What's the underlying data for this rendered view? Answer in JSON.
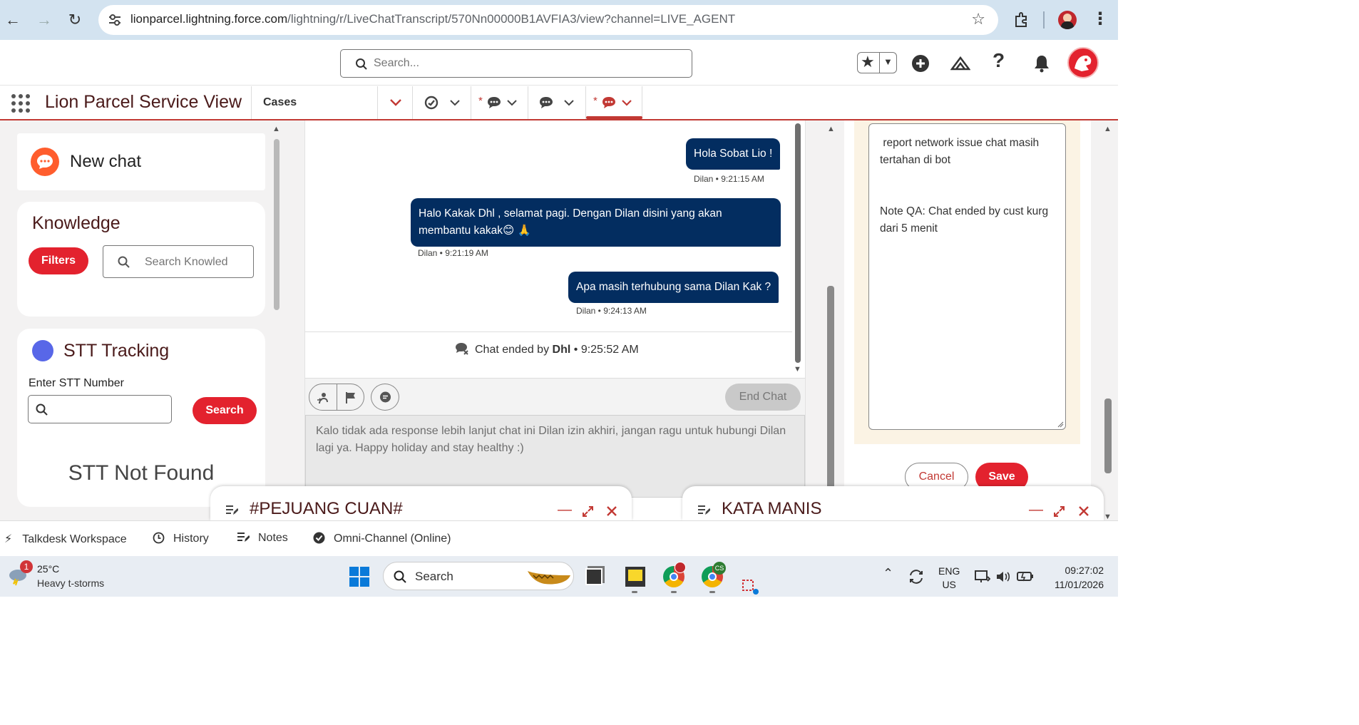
{
  "browser": {
    "url_host": "lionparcel.lightning.force.com",
    "url_path": "/lightning/r/LiveChatTranscript/570Nn00000B1AVFIA3/view?channel=LIVE_AGENT"
  },
  "header": {
    "search_placeholder": "Search..."
  },
  "appnav": {
    "app_name": "Lion Parcel Service View",
    "cases_tab": "Cases",
    "tab_star": "*"
  },
  "left": {
    "new_chat": "New chat",
    "knowledge_title": "Knowledge",
    "filters_label": "Filters",
    "knowledge_search_placeholder": "Search Knowled",
    "stt_title": "STT Tracking",
    "stt_label": "Enter STT Number",
    "stt_search_button": "Search",
    "stt_not_found": "STT Not Found"
  },
  "chat": {
    "messages": [
      {
        "text": "Hola Sobat Lio !",
        "stamp": "Dilan • 9:21:15 AM"
      },
      {
        "text": "Halo Kakak Dhl , selamat pagi. Dengan Dilan disini yang akan membantu kakak😊 🙏",
        "stamp": "Dilan • 9:21:19 AM"
      },
      {
        "text": "Apa masih terhubung sama Dilan Kak ?",
        "stamp": "Dilan • 9:24:13 AM"
      }
    ],
    "ended_prefix": "Chat ended by",
    "ended_by": "Dhl",
    "ended_time": "• 9:25:52 AM",
    "end_chat_label": "End Chat",
    "draft": "Kalo tidak ada response lebih lanjut chat ini Dilan izin akhiri, jangan ragu untuk hubungi Dilan lagi ya. Happy holiday and stay healthy :)"
  },
  "notes": {
    "text": " report network issue chat masih tertahan di bot\n\n\nNote QA: Chat ended by cust kurg dari 5 menit",
    "cancel_label": "Cancel",
    "save_label": "Save"
  },
  "docked": {
    "left_title": "#PEJUANG CUAN#",
    "right_title": "KATA MANIS"
  },
  "utility": {
    "items": [
      "Talkdesk Workspace",
      "History",
      "Notes",
      "Omni-Channel (Online)"
    ]
  },
  "taskbar": {
    "weather_badge": "1",
    "temperature": "25°C",
    "weather_desc": "Heavy t-storms",
    "search_label": "Search",
    "chrome_badge": "CS",
    "lang_top": "ENG",
    "lang_bottom": "US",
    "time": "09:27:02",
    "date": "11/01/2026"
  },
  "colors": {
    "brand_red": "#e3222e",
    "chat_bubble": "#032d60",
    "app_name": "#4a1a1a",
    "notes_bg": "#fbf3e4"
  }
}
